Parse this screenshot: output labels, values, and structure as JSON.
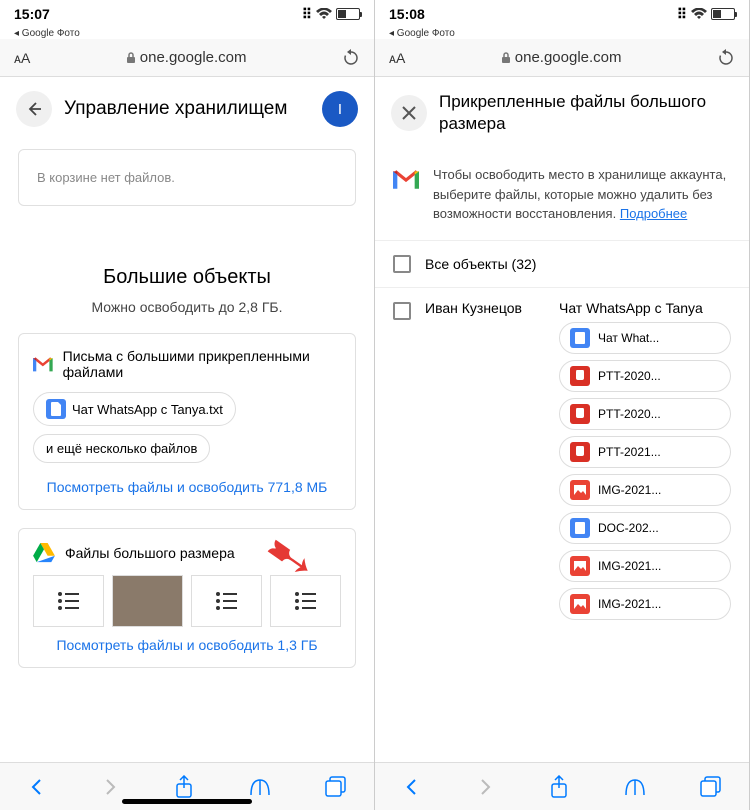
{
  "left": {
    "status_time": "15:07",
    "back_app": "◂ Google Фото",
    "url": "one.google.com",
    "aa": "ᴀA",
    "page_title": "Управление хранилищем",
    "avatar_initial": "I",
    "trash_text": "В корзине нет файлов.",
    "big_heading": "Большие объекты",
    "sub": "Можно освободить до 2,8 ГБ.",
    "gmail_card_title": "Письма с большими прикрепленными файлами",
    "chip1": "Чат WhatsApp с Tanya.txt",
    "chip2": "и ещё несколько файлов",
    "link1": "Посмотреть файлы и освободить 771,8 МБ",
    "drive_card_title": "Файлы большого размера",
    "link2": "Посмотреть файлы и освободить 1,3 ГБ"
  },
  "right": {
    "status_time": "15:08",
    "back_app": "◂ Google Фото",
    "url": "one.google.com",
    "aa": "ᴀA",
    "page_title": "Прикрепленные файлы большого размера",
    "info_text": "Чтобы освободить место в хранилище аккаунта, выберите файлы, которые можно удалить без возможности восстановления.",
    "info_link": "Подробнее",
    "all_items": "Все объекты (32)",
    "sender": "Иван Кузнецов",
    "chat_title": "Чат WhatsApp с Tanya",
    "files": [
      {
        "type": "doc",
        "label": "Чат What..."
      },
      {
        "type": "audio",
        "label": "PTT-2020..."
      },
      {
        "type": "audio",
        "label": "PTT-2020..."
      },
      {
        "type": "audio",
        "label": "PTT-2021..."
      },
      {
        "type": "img",
        "label": "IMG-2021..."
      },
      {
        "type": "doc",
        "label": "DOC-202..."
      },
      {
        "type": "img",
        "label": "IMG-2021..."
      },
      {
        "type": "img",
        "label": "IMG-2021..."
      }
    ]
  }
}
